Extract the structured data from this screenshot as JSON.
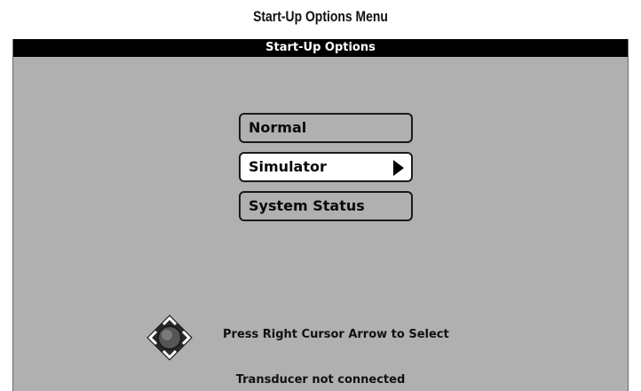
{
  "caption": "Start-Up Options Menu",
  "screen": {
    "title": "Start-Up Options",
    "menu_items": [
      {
        "label": "Normal",
        "selected": false
      },
      {
        "label": "Simulator",
        "selected": true
      },
      {
        "label": "System Status",
        "selected": false
      }
    ],
    "selected_index": 1,
    "hint_icon": "four-way-cursor-pad-icon",
    "hint_text": "Press Right Cursor Arrow to Select",
    "status_text": "Transducer not connected"
  },
  "colors": {
    "screen_background": "#b0b0b0",
    "title_bar": "#000000",
    "selected_item": "#ffffff"
  }
}
